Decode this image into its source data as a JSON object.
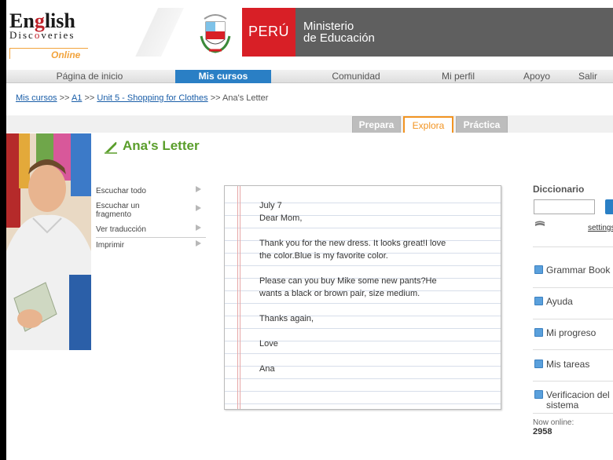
{
  "header": {
    "logo": {
      "word_before": "En",
      "word_g": "g",
      "word_after": "lish",
      "line2_before": "Disc",
      "line2_o": "o",
      "line2_after": "veries",
      "line3": "Online"
    },
    "country": "PERÚ",
    "ministry_line1": "Ministerio",
    "ministry_line2": "de Educación"
  },
  "nav": {
    "items": [
      {
        "label": "Página de inicio"
      },
      {
        "label": "Mis cursos"
      },
      {
        "label": "Comunidad"
      },
      {
        "label": "Mi perfil"
      },
      {
        "label": "Apoyo"
      },
      {
        "label": "Salir"
      }
    ],
    "active": "Mis cursos"
  },
  "breadcrumb": {
    "link1": "Mis cursos",
    "link2": "A1",
    "link3": "Unit 5 - Shopping for Clothes",
    "sep": ">>",
    "current": "Ana's Letter"
  },
  "tabs": [
    {
      "label": "Prepara"
    },
    {
      "label": "Explora"
    },
    {
      "label": "Práctica"
    }
  ],
  "lesson": {
    "title": "Ana's Letter"
  },
  "side_menu": [
    {
      "label": "Escuchar todo"
    },
    {
      "label": "Escuchar un fragmento"
    },
    {
      "label": "Ver traducción"
    },
    {
      "label": "Imprimir"
    }
  ],
  "letter": {
    "date": "July 7",
    "greeting": "Dear Mom,",
    "p1_line1": "Thank you for the new dress. It looks great!I love",
    "p1_line2": "the color.Blue is my favorite color.",
    "p2_line1": "Please can you buy Mike some new pants?He",
    "p2_line2": "wants a black or brown pair, size medium.",
    "thanks": "Thanks again,",
    "closing": "Love",
    "signature": "Ana"
  },
  "right": {
    "dictionary_title": "Diccionario",
    "dictionary_value": "",
    "settings": "settings",
    "items": [
      {
        "label": "Grammar Book"
      },
      {
        "label": "Ayuda"
      },
      {
        "label": "Mi progreso"
      },
      {
        "label": "Mis tareas"
      },
      {
        "label": "Verificacion del sistema"
      }
    ],
    "now_online_label": "Now online:",
    "now_online_count": "2958"
  }
}
